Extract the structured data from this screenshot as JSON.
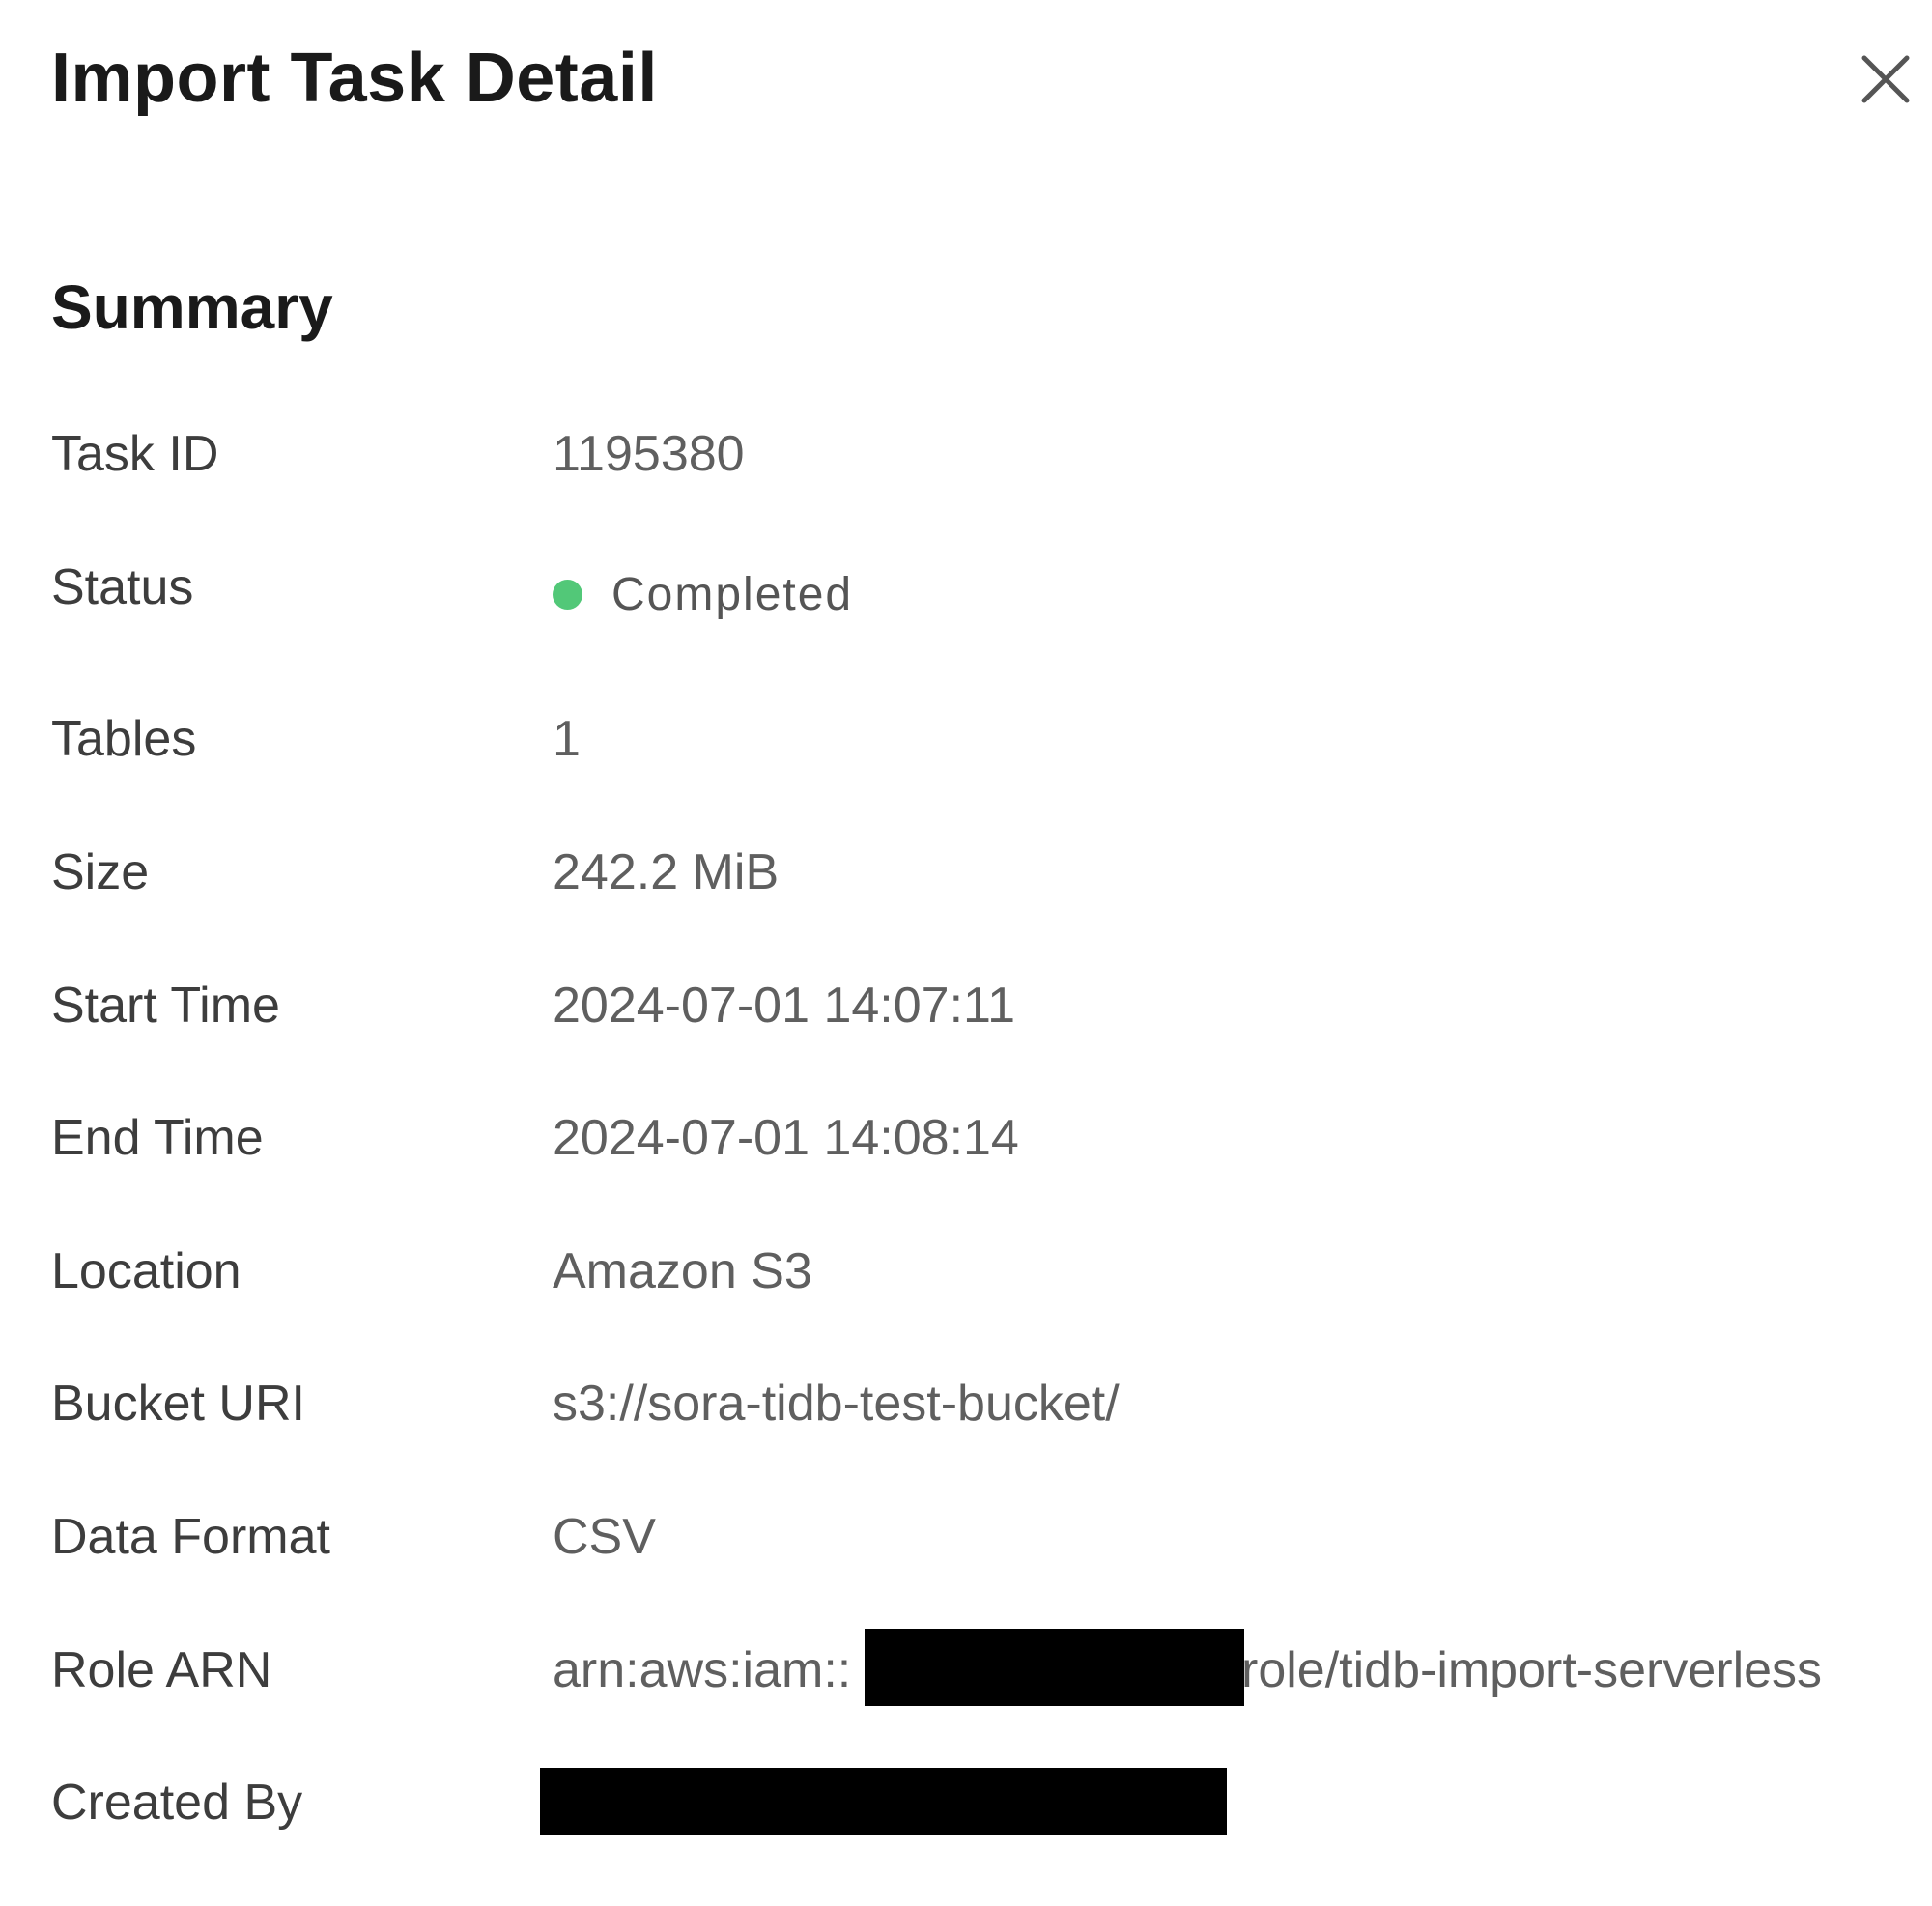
{
  "dialog": {
    "title": "Import Task Detail",
    "close_icon": "close-icon"
  },
  "summary": {
    "heading": "Summary",
    "rows": [
      {
        "label": "Task ID",
        "value": "1195380"
      },
      {
        "label": "Status",
        "value": "Completed",
        "status_color": "#52c878"
      },
      {
        "label": "Tables",
        "value": "1"
      },
      {
        "label": "Size",
        "value": "242.2 MiB"
      },
      {
        "label": "Start Time",
        "value": "2024-07-01 14:07:11"
      },
      {
        "label": "End Time",
        "value": "2024-07-01 14:08:14"
      },
      {
        "label": "Location",
        "value": "Amazon S3"
      },
      {
        "label": "Bucket URI",
        "value": "s3://sora-tidb-test-bucket/"
      },
      {
        "label": "Data Format",
        "value": "CSV"
      },
      {
        "label": "Role ARN",
        "value_prefix": "arn:aws:iam::",
        "value_suffix": "role/tidb-import-serverless",
        "redacted": true
      },
      {
        "label": "Created By",
        "redacted": true
      }
    ]
  }
}
